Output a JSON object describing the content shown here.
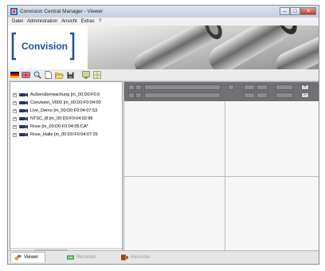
{
  "window": {
    "title": "Convision Central Manager - Viewer"
  },
  "menu": [
    "Datei",
    "Administration",
    "Ansicht",
    "Extras",
    "?"
  ],
  "logo": {
    "text": "Convision"
  },
  "toolbar": {
    "icons": [
      "flag-de-icon",
      "flag-uk-icon",
      "search-icon",
      "new-document-icon",
      "open-folder-icon",
      "save-icon",
      "monitor-icon",
      "grid-icon"
    ]
  },
  "tree": {
    "items": [
      {
        "label": "Außenüberwachung [m_00:D0:F0:0"
      },
      {
        "label": "Convision_V600 [m_00:D0:F0:04:00"
      },
      {
        "label": "Live_Demo [m_00:D0:F0:04:07:53"
      },
      {
        "label": "NTSC_i8 [m_00:D0:F0:04:02:86"
      },
      {
        "label": "Rose [m_00:D0:F0:04:05:CA*"
      },
      {
        "label": "Rose_Halle [m_00:D0:F0:04:07:25"
      }
    ]
  },
  "tabs": [
    {
      "label": "Viewer",
      "active": true
    },
    {
      "label": "Recorder",
      "active": false
    },
    {
      "label": "Recorder",
      "active": false
    }
  ]
}
